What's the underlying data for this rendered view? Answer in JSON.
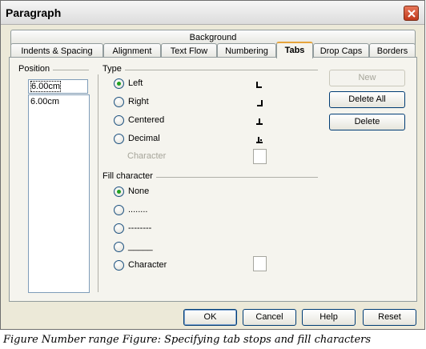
{
  "window": {
    "title": "Paragraph"
  },
  "tabs": {
    "row_top": [
      "Background"
    ],
    "row_bottom": [
      "Indents & Spacing",
      "Alignment",
      "Text Flow",
      "Numbering",
      "Tabs",
      "Drop Caps",
      "Borders"
    ],
    "active": "Tabs"
  },
  "position": {
    "label": "Position",
    "input_value": "6.00cm",
    "list_items": [
      "6.00cm"
    ]
  },
  "type": {
    "label": "Type",
    "options": [
      "Left",
      "Right",
      "Centered",
      "Decimal"
    ],
    "selected": "Left",
    "character_label": "Character"
  },
  "fill": {
    "label": "Fill character",
    "options": [
      "None",
      "........",
      "--------",
      "_____",
      "Character"
    ],
    "selected": "None"
  },
  "side_buttons": {
    "new": "New",
    "delete_all": "Delete All",
    "delete": "Delete"
  },
  "footer": {
    "ok": "OK",
    "cancel": "Cancel",
    "help": "Help",
    "reset": "Reset"
  },
  "caption": "Figure Number range Figure: Specifying tab stops and fill characters"
}
